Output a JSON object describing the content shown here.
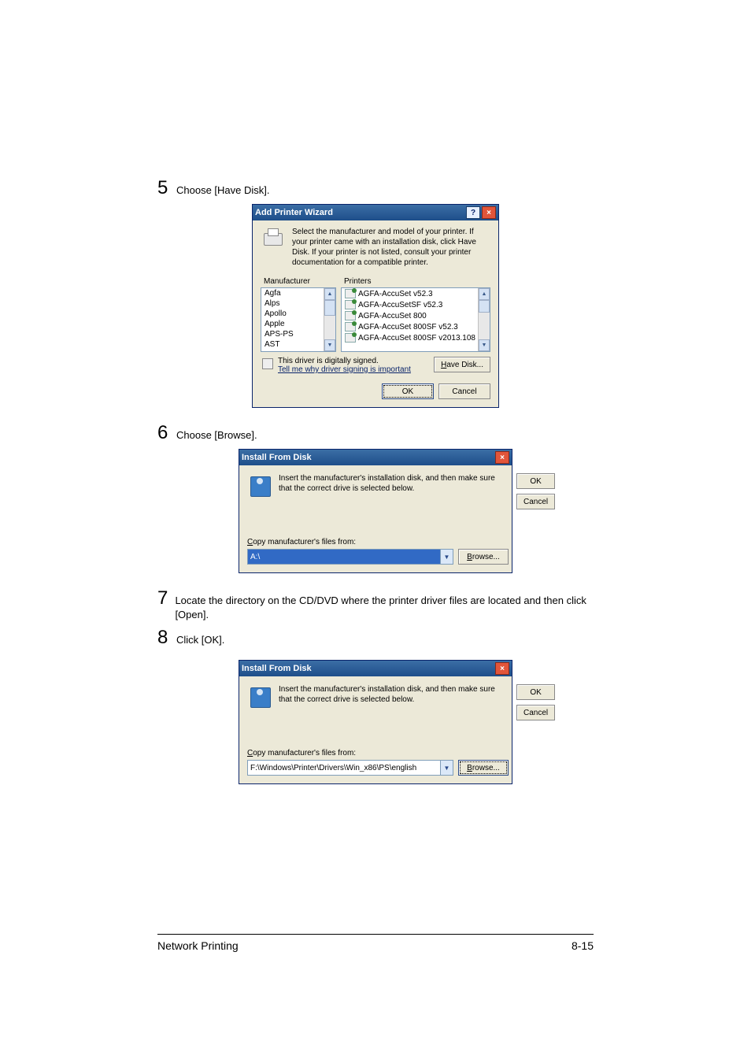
{
  "steps": {
    "s5": {
      "num": "5",
      "text": "Choose [Have Disk]."
    },
    "s6": {
      "num": "6",
      "text": "Choose [Browse]."
    },
    "s7": {
      "num": "7",
      "text": "Locate the directory on the CD/DVD where the printer driver files are located and then click [Open]."
    },
    "s8": {
      "num": "8",
      "text": "Click [OK]."
    }
  },
  "addPrinter": {
    "title": "Add Printer Wizard",
    "help": "?",
    "close": "×",
    "intro": "Select the manufacturer and model of your printer. If your printer came with an installation disk, click Have Disk. If your printer is not listed, consult your printer documentation for a compatible printer.",
    "manuLabel": "Manufacturer",
    "printersLabel": "Printers",
    "manufacturers": [
      "Agfa",
      "Alps",
      "Apollo",
      "Apple",
      "APS-PS",
      "AST"
    ],
    "printers": [
      "AGFA-AccuSet v52.3",
      "AGFA-AccuSetSF v52.3",
      "AGFA-AccuSet 800",
      "AGFA-AccuSet 800SF v52.3",
      "AGFA-AccuSet 800SF v2013.108"
    ],
    "signed": "This driver is digitally signed.",
    "signedLink": "Tell me why driver signing is important",
    "haveDisk": "Have Disk...",
    "ok": "OK",
    "cancel": "Cancel"
  },
  "install1": {
    "title": "Install From Disk",
    "close": "×",
    "msg": "Insert the manufacturer's installation disk, and then make sure that the correct drive is selected below.",
    "copyLabel": "Copy manufacturer's files from:",
    "value": "A:\\",
    "ok": "OK",
    "cancel": "Cancel",
    "browse": "Browse..."
  },
  "install2": {
    "title": "Install From Disk",
    "close": "×",
    "msg": "Insert the manufacturer's installation disk, and then make sure that the correct drive is selected below.",
    "copyLabel": "Copy manufacturer's files from:",
    "value": "F:\\Windows\\Printer\\Drivers\\Win_x86\\PS\\english",
    "ok": "OK",
    "cancel": "Cancel",
    "browse": "Browse..."
  },
  "footer": {
    "left": "Network Printing",
    "right": "8-15"
  },
  "labels": {
    "copyC": "C",
    "copyRest": "opy manufacturer's files from:",
    "haveH": "H",
    "haveRest": "ave Disk...",
    "browseB": "B",
    "browseRest": "rowse..."
  }
}
